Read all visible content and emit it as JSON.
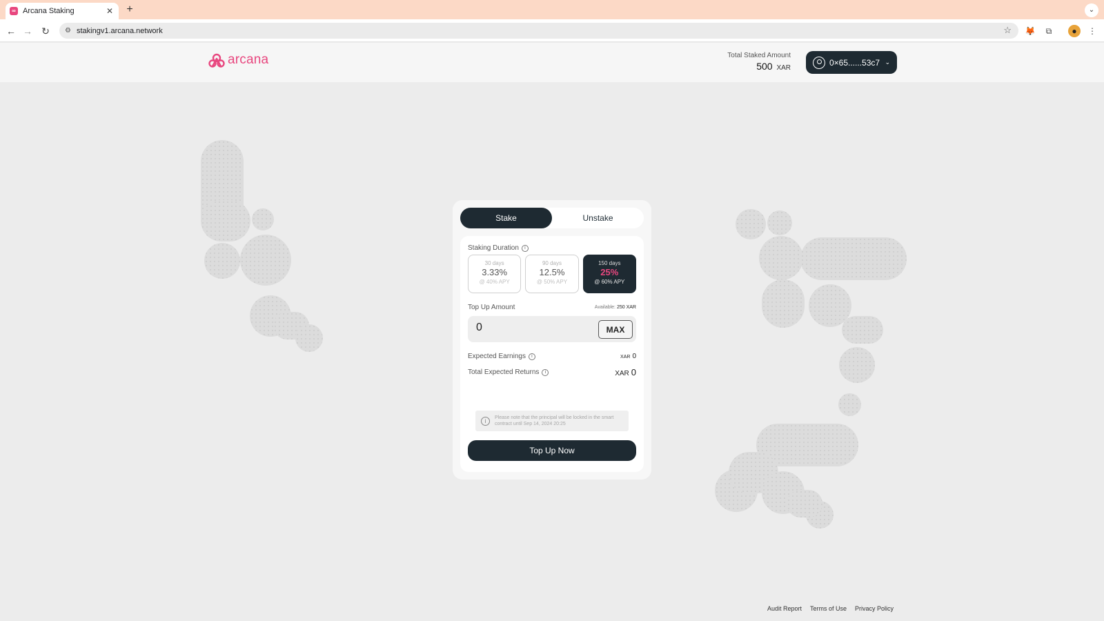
{
  "browser": {
    "tab_title": "Arcana Staking",
    "tab_favicon": "arcana-favicon",
    "url": "stakingv1.arcana.network"
  },
  "header": {
    "logo_text": "arcana",
    "total_staked_label": "Total Staked Amount",
    "total_staked_value": "500",
    "total_staked_unit": "XAR",
    "wallet_address": "0×65......53c7"
  },
  "card": {
    "tabs": [
      {
        "label": "Stake",
        "active": true
      },
      {
        "label": "Unstake",
        "active": false
      }
    ],
    "staking_duration_label": "Staking Duration",
    "durations": [
      {
        "days": "30 days",
        "rate": "3.33%",
        "apy": "@ 40% APY",
        "selected": false
      },
      {
        "days": "90 days",
        "rate": "12.5%",
        "apy": "@ 50% APY",
        "selected": false
      },
      {
        "days": "150 days",
        "rate": "25%",
        "apy": "@ 60% APY",
        "selected": true
      }
    ],
    "top_up_label": "Top Up Amount",
    "available_label": "Available:",
    "available_value": "250 XAR",
    "amount_value": "0",
    "max_label": "MAX",
    "expected_earnings_label": "Expected Earnings",
    "expected_earnings_unit": "XAR",
    "expected_earnings_value": "0",
    "total_returns_label": "Total Expected Returns",
    "total_returns_unit": "XAR",
    "total_returns_value": "0",
    "note_text": "Please note that the principal will be locked in the smart contract until Sep 14, 2024 20:25",
    "submit_label": "Top Up Now"
  },
  "footer": {
    "links": [
      "Audit Report",
      "Terms of Use",
      "Privacy Policy"
    ]
  },
  "colors": {
    "accent": "#e8477f",
    "dark": "#1e2a32",
    "background": "#ececec"
  }
}
